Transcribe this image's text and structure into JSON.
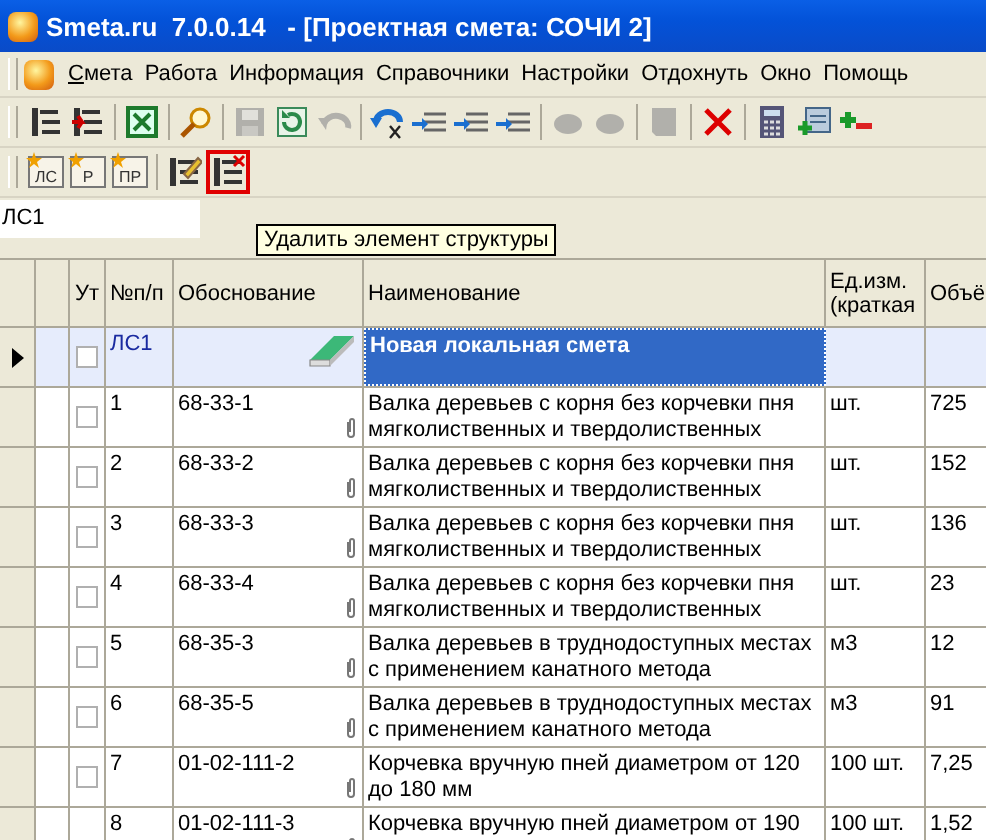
{
  "window": {
    "title": "Smeta.ru  7.0.0.14   - [Проектная смета: СОЧИ 2]"
  },
  "menu": [
    {
      "label": "Смета",
      "first_letter_underlined": true
    },
    {
      "label": "Работа"
    },
    {
      "label": "Информация"
    },
    {
      "label": "Справочники"
    },
    {
      "label": "Настройки"
    },
    {
      "label": "Отдохнуть"
    },
    {
      "label": "Окно"
    },
    {
      "label": "Помощь"
    }
  ],
  "toolbar_1": [
    {
      "kind": "tree",
      "disabled": false
    },
    {
      "kind": "tree-insert",
      "disabled": false
    },
    {
      "kind": "sep"
    },
    {
      "kind": "sheet",
      "disabled": false
    },
    {
      "kind": "sep"
    },
    {
      "kind": "search",
      "disabled": false
    },
    {
      "kind": "sep"
    },
    {
      "kind": "save",
      "disabled": true
    },
    {
      "kind": "refresh",
      "disabled": false
    },
    {
      "kind": "undo",
      "disabled": true
    },
    {
      "kind": "sep"
    },
    {
      "kind": "undo-blue",
      "disabled": false
    },
    {
      "kind": "list-arrow",
      "disabled": false
    },
    {
      "kind": "list-arrow",
      "disabled": false
    },
    {
      "kind": "list-arrow",
      "disabled": false
    },
    {
      "kind": "sep"
    },
    {
      "kind": "blob",
      "disabled": true
    },
    {
      "kind": "blob",
      "disabled": true
    },
    {
      "kind": "sep"
    },
    {
      "kind": "page",
      "disabled": true
    },
    {
      "kind": "sep"
    },
    {
      "kind": "delete",
      "disabled": false
    },
    {
      "kind": "sep"
    },
    {
      "kind": "calculator",
      "disabled": false
    },
    {
      "kind": "card",
      "disabled": false
    },
    {
      "kind": "plus-minus",
      "disabled": false
    }
  ],
  "toolbar_2": [
    {
      "kind": "new-doc",
      "label": "ЛС",
      "highlighted": false
    },
    {
      "kind": "new-doc",
      "label": "Р",
      "highlighted": false
    },
    {
      "kind": "new-doc",
      "label": "ПР",
      "highlighted": false
    },
    {
      "kind": "sep"
    },
    {
      "kind": "tree-edit",
      "highlighted": false
    },
    {
      "kind": "tree-delete",
      "highlighted": true
    }
  ],
  "path_field": {
    "value": "ЛС1"
  },
  "tooltip": {
    "text": "Удалить элемент структуры"
  },
  "table": {
    "columns": [
      "Ут",
      "№п/п",
      "Обоснование",
      "Наименование",
      "Ед.изм. (краткая",
      "Объё"
    ],
    "rows": [
      {
        "kind": "section",
        "selected": true,
        "checked": false,
        "number": "ЛС1",
        "basis": "",
        "name": "Новая локальная смета",
        "unit": "",
        "volume": ""
      },
      {
        "kind": "item",
        "selected": false,
        "checked": false,
        "number": "1",
        "basis": "68-33-1",
        "name": "Валка деревьев с корня без корчевки пня мягколиственных и твердолиственных",
        "unit": "шт.",
        "volume": "725"
      },
      {
        "kind": "item",
        "selected": false,
        "checked": false,
        "number": "2",
        "basis": "68-33-2",
        "name": "Валка деревьев с корня без корчевки пня мягколиственных и твердолиственных",
        "unit": "шт.",
        "volume": "152"
      },
      {
        "kind": "item",
        "selected": false,
        "checked": false,
        "number": "3",
        "basis": "68-33-3",
        "name": "Валка деревьев с корня без корчевки пня мягколиственных и твердолиственных",
        "unit": "шт.",
        "volume": "136"
      },
      {
        "kind": "item",
        "selected": false,
        "checked": false,
        "number": "4",
        "basis": "68-33-4",
        "name": "Валка деревьев с корня без корчевки пня мягколиственных и твердолиственных",
        "unit": "шт.",
        "volume": "23"
      },
      {
        "kind": "item",
        "selected": false,
        "checked": false,
        "number": "5",
        "basis": "68-35-3",
        "name": "Валка деревьев в труднодоступных местах с применением канатного метода",
        "unit": "м3",
        "volume": "12"
      },
      {
        "kind": "item",
        "selected": false,
        "checked": false,
        "number": "6",
        "basis": "68-35-5",
        "name": "Валка деревьев в труднодоступных местах с применением канатного метода",
        "unit": "м3",
        "volume": "91"
      },
      {
        "kind": "item",
        "selected": false,
        "checked": false,
        "number": "7",
        "basis": "01-02-111-2",
        "name": "Корчевка вручную пней диаметром от 120 до 180 мм",
        "unit": "100 шт.",
        "volume": "7,25"
      },
      {
        "kind": "item",
        "selected": false,
        "number": "8",
        "basis": "01-02-111-3",
        "name": "Корчевка вручную пней диаметром от 190",
        "unit": "100 шт.",
        "volume": "1,52"
      }
    ]
  }
}
